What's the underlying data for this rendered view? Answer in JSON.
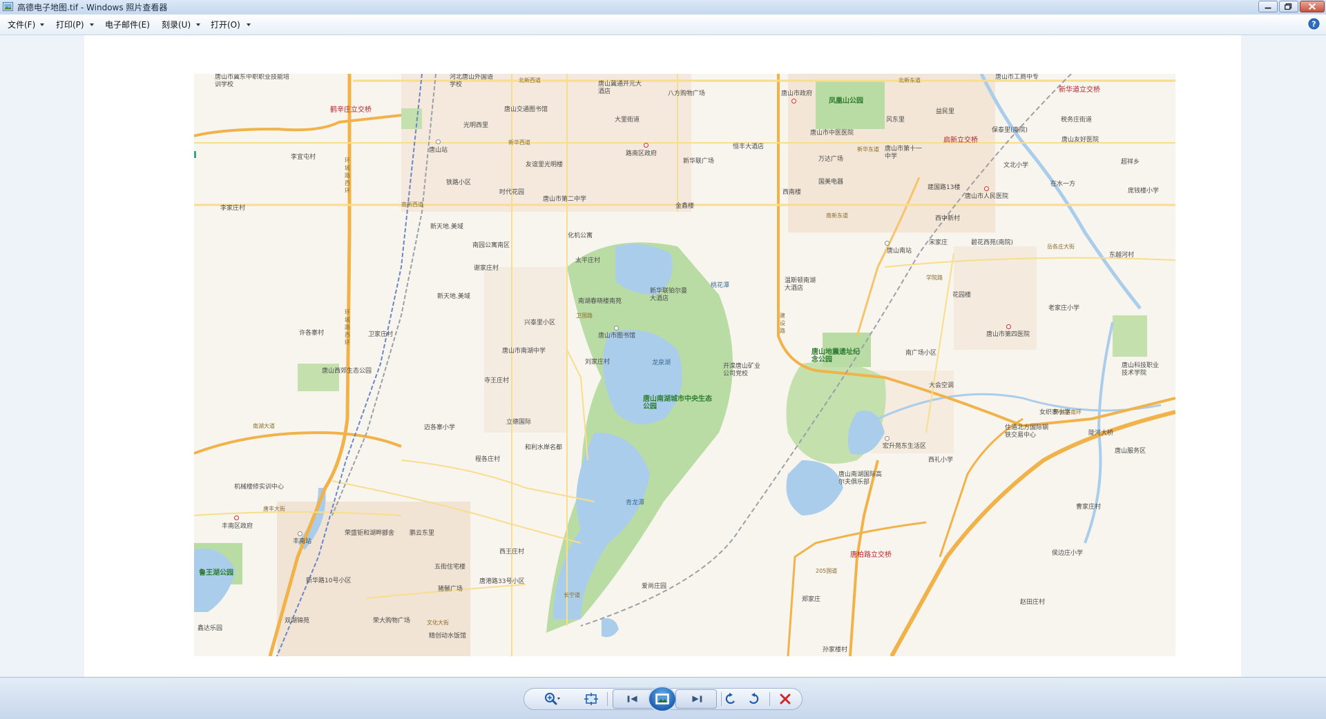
{
  "window": {
    "title": "高德电子地图.tif - Windows 照片查看器"
  },
  "menu": {
    "items": [
      {
        "label": "文件(F)",
        "dropdown": true
      },
      {
        "label": "打印(P)",
        "dropdown": true
      },
      {
        "label": "电子邮件(E)",
        "dropdown": false
      },
      {
        "label": "刻录(U)",
        "dropdown": true
      },
      {
        "label": "打开(O)",
        "dropdown": true
      }
    ],
    "help_icon": "help-icon"
  },
  "map": {
    "labels_red": [
      "鹤辛庄立交桥",
      "新华道立交桥",
      "启新立交桥",
      "唐柏路立交桥"
    ],
    "labels_park": [
      "凤凰山公园",
      "唐山地震遗址纪念公园",
      "唐山南湖城市中央生态公园",
      "鲁王湖公园"
    ],
    "labels_water": [
      "龙泉湖",
      "青龙潭",
      "桃花潭"
    ],
    "labels_roads": [
      "北新西道",
      "北新东道",
      "新华西道",
      "新华东道",
      "南新西道",
      "南新东道",
      "南湖大道",
      "环城路西环",
      "环城路南环",
      "环城路西环",
      "建设路",
      "唐丰大街",
      "文化大街",
      "205国道",
      "卫国路",
      "学院路",
      "岳各庄大街",
      "长宁道"
    ],
    "labels_poi": [
      "唐山市冀东中职职业技能培训学校",
      "河北唐山外国语学校",
      "唐山冀通开元大酒店",
      "八方购物广场",
      "唐山市政府",
      "唐山市工商中专",
      "唐山交通图书馆",
      "光明西里",
      "大里街道",
      "唐山站",
      "李宜屯村",
      "路南区政府",
      "友谊里光明楼",
      "新华联广场",
      "恒丰大酒店",
      "唐山市中医医院",
      "万达广场",
      "唐山市第十一中学",
      "益民里",
      "风东里",
      "税务庄街道",
      "唐山友好医院",
      "保泰里(南院)",
      "超祥乡",
      "文北小学",
      "铁路小区",
      "时代花园",
      "唐山市第二中学",
      "金鑫楼",
      "国美电器",
      "西南楼",
      "建国路13楼",
      "唐山市人民医院",
      "在水一方",
      "庞钱楼小学",
      "李家庄村",
      "新天地.美域",
      "化机公寓",
      "西中新村",
      "宋家庄",
      "唐山南站",
      "碧花西苑(南院)",
      "东越河村",
      "南园公寓南区",
      "谢家庄村",
      "太平庄村",
      "温斯顿南湖大酒店",
      "花园楼",
      "新天地.美域",
      "新华联铂尔曼大酒店",
      "南湖春晓楼南苑",
      "老家庄小学",
      "兴泰里小区",
      "唐山市图书馆",
      "许各寨村",
      "卫家庄村",
      "唐山市南湖中学",
      "唐山市第四医院",
      "南广场小区",
      "刘家庄村",
      "开滦唐山矿业公司党校",
      "寺王庄村",
      "唐山西郊生态公园",
      "大会空调",
      "唐山科技职业技术学院",
      "迈各寨小学",
      "立德国际",
      "女织寨小学",
      "住通北方国际钢铁交易中心",
      "宏升苑东生活区",
      "和利水岸名都",
      "程各庄村",
      "唐山南湖国际高尔夫俱乐部",
      "西礼小学",
      "唐山服务区",
      "陡河大桥",
      "机械楼修实训中心",
      "丰南区政府",
      "丰南站",
      "荣盛钜和湖畔郦舍",
      "鹏云东里",
      "西王庄村",
      "侯边庄小学",
      "曹家庄村",
      "新华路10号小区",
      "五街住宅楼",
      "猪鬃广场",
      "唐港路33号小区",
      "爱尚庄园",
      "郑家庄",
      "赵田庄村",
      "双湖锦苑",
      "荣大购物广场",
      "精创动水饭馆",
      "鑫达乐园",
      "孙家楼村"
    ]
  },
  "toolbar": {
    "buttons": [
      "zoom-button",
      "fit-window-button",
      "previous-button",
      "slideshow-button",
      "next-button",
      "rotate-left-button",
      "rotate-right-button",
      "delete-button"
    ]
  },
  "colors": {
    "titlebar": "#c6d8ef",
    "map_bg": "#f8f5ee",
    "park": "#b9dca4",
    "water": "#a9cdea",
    "major_road": "#f2b24a",
    "railway": "#9aa0a6"
  }
}
